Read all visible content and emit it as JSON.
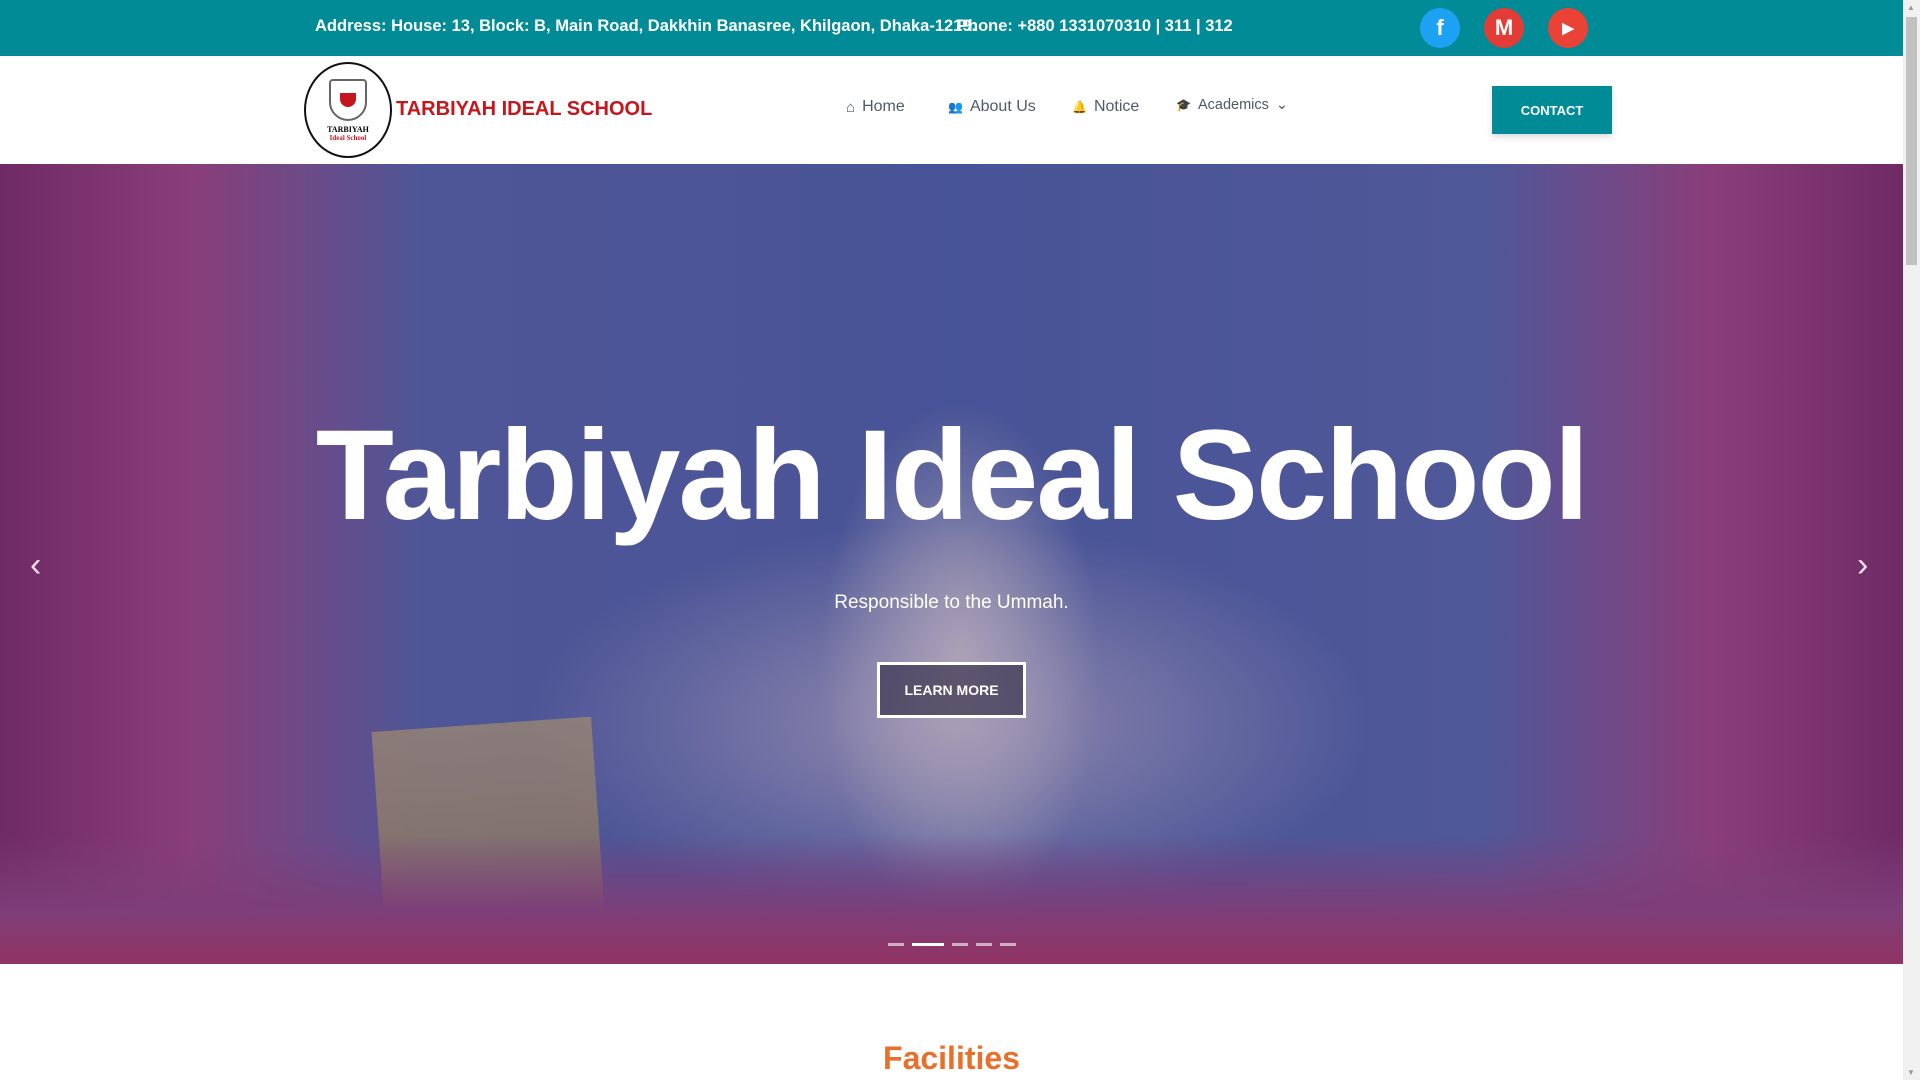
{
  "topbar": {
    "address": "Address: House: 13, Block: B, Main Road, Dakkhin Banasree, Khilgaon, Dhaka-1219.",
    "phone": "Phone: +880 1331070310 | 311 | 312",
    "social": [
      {
        "name": "facebook",
        "glyph": "f",
        "color": "#1da1f2"
      },
      {
        "name": "gmail",
        "glyph": "M",
        "color": "#e33b36"
      },
      {
        "name": "youtube",
        "glyph": "▶",
        "color": "#ea4335"
      }
    ]
  },
  "nav": {
    "logo_line1": "TARBIYAH",
    "logo_line2": "Ideal School",
    "brand": "TARBIYAH IDEAL SCHOOL",
    "items": [
      {
        "label": "Home",
        "icon": "⌂"
      },
      {
        "label": "About Us",
        "icon": "👥"
      },
      {
        "label": "Notice",
        "icon": "🔔"
      },
      {
        "label": "Academics",
        "icon": "🎓",
        "caret": "⌄"
      }
    ],
    "contact": "CONTACT"
  },
  "hero": {
    "title": "Tarbiyah Ideal School",
    "subtitle": "Responsible to the Ummah.",
    "button": "LEARN MORE",
    "prev": "‹",
    "next": "›",
    "slides": 5,
    "active_slide": 2
  },
  "section": {
    "title": "Facilities"
  }
}
